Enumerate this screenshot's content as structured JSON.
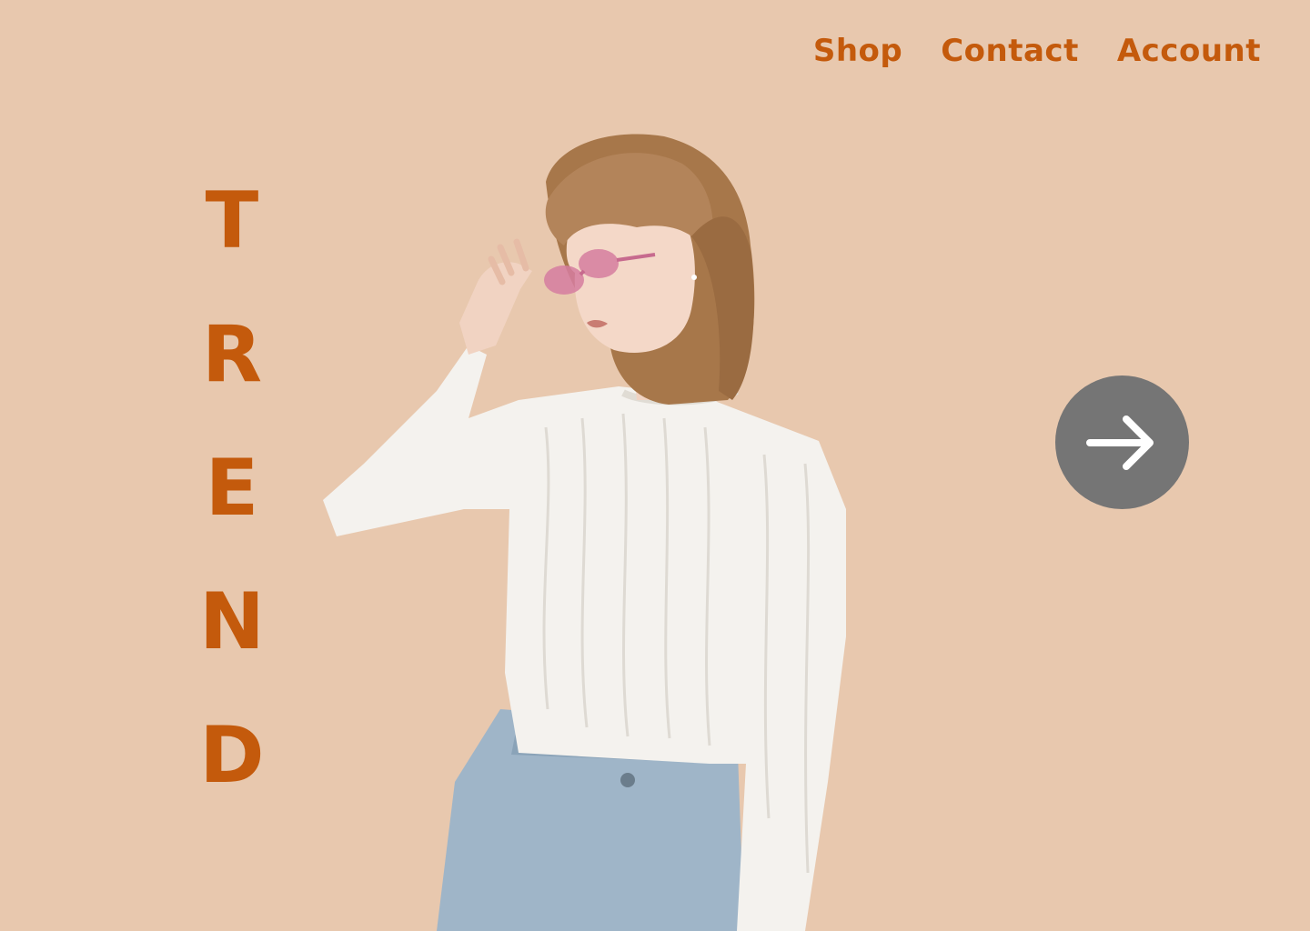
{
  "nav": {
    "items": [
      {
        "label": "Shop"
      },
      {
        "label": "Contact"
      },
      {
        "label": "Account"
      }
    ]
  },
  "hero": {
    "letters": [
      "T",
      "R",
      "E",
      "N",
      "D"
    ]
  },
  "next_button": {
    "icon": "arrow-right-icon"
  },
  "colors": {
    "background": "#e8c8ae",
    "accent": "#c45a0c",
    "button": "#757575"
  }
}
